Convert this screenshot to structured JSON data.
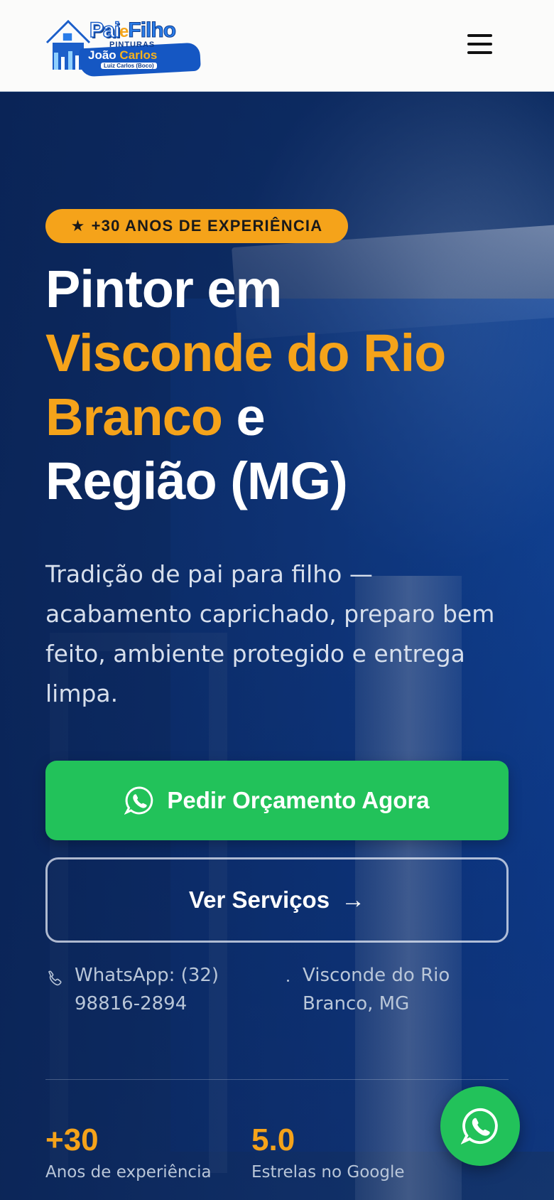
{
  "logo": {
    "title_pai": "Pai",
    "title_e": "e",
    "title_filho": "Filho",
    "sub1": "PINTURAS",
    "sub2_a": "João",
    "sub2_b": "Carlos",
    "sub3": "Luiz Carlos (Boco)"
  },
  "header": {
    "menu_icon": "hamburger-menu-icon"
  },
  "hero": {
    "badge_star": "★",
    "badge": "+30 ANOS DE EXPERIÊNCIA",
    "headline_1": "Pintor em",
    "headline_hl": "Visconde do Rio Branco",
    "headline_2": "e",
    "headline_3": "Região (MG)",
    "lead": "Tradição de pai para filho — acabamento caprichado, preparo bem feito, ambiente protegido e entrega limpa.",
    "cta_primary": "Pedir Orçamento Agora",
    "cta_secondary": "Ver Serviços",
    "cta_secondary_arrow": "→",
    "contact_whatsapp": "WhatsApp: (32) 98816-2894",
    "contact_location": "Visconde do Rio Branco, MG"
  },
  "stats": [
    {
      "value": "+30",
      "label": "Anos de experiência"
    },
    {
      "value": "5.0",
      "label": "Estrelas no Google"
    }
  ],
  "colors": {
    "accent": "#f5a31a",
    "whatsapp_green": "#22c25a",
    "hero_blue": "#0d2d63"
  },
  "icons": [
    "hamburger-menu-icon",
    "whatsapp-icon",
    "phone-icon",
    "arrow-right-icon",
    "star-icon"
  ]
}
